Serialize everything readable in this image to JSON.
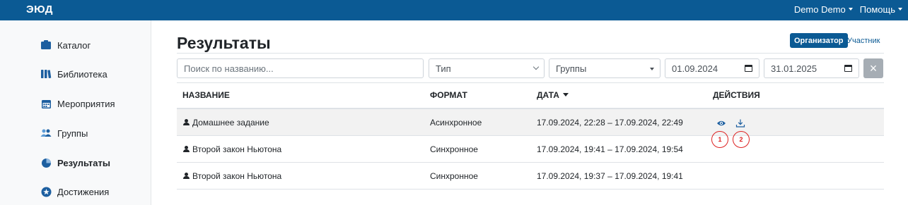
{
  "topbar": {
    "logo": "ЭЮД",
    "user": "Demo Demo",
    "help": "Помощь"
  },
  "sidebar": {
    "items": [
      {
        "label": "Каталог",
        "icon": "catalog-icon"
      },
      {
        "label": "Библиотека",
        "icon": "library-icon"
      },
      {
        "label": "Мероприятия",
        "icon": "calendar-icon"
      },
      {
        "label": "Группы",
        "icon": "groups-icon"
      },
      {
        "label": "Результаты",
        "icon": "results-icon",
        "active": true
      },
      {
        "label": "Достижения",
        "icon": "achievements-icon"
      }
    ]
  },
  "page": {
    "title": "Результаты"
  },
  "roles": {
    "organizer": "Организатор",
    "participant": "Участник"
  },
  "filters": {
    "search_placeholder": "Поиск по названию...",
    "type_placeholder": "Тип",
    "groups_placeholder": "Группы",
    "date_from": "01.09.2024",
    "date_to": "31.01.2025",
    "clear": "×"
  },
  "table": {
    "headers": {
      "name": "НАЗВАНИЕ",
      "format": "ФОРМАТ",
      "date": "ДАТА",
      "actions": "ДЕЙСТВИЯ"
    },
    "rows": [
      {
        "name": "Домашнее задание",
        "format": "Асинхронное",
        "date": "17.09.2024, 22:28 – 17.09.2024, 22:49"
      },
      {
        "name": "Второй закон Ньютона",
        "format": "Синхронное",
        "date": "17.09.2024, 19:41 – 17.09.2024, 19:54"
      },
      {
        "name": "Второй закон Ньютона",
        "format": "Синхронное",
        "date": "17.09.2024, 19:37 – 17.09.2024, 19:41"
      }
    ]
  },
  "markers": {
    "one": "1",
    "two": "2"
  },
  "colors": {
    "brand": "#0b5a94",
    "marker": "#dd2222"
  }
}
